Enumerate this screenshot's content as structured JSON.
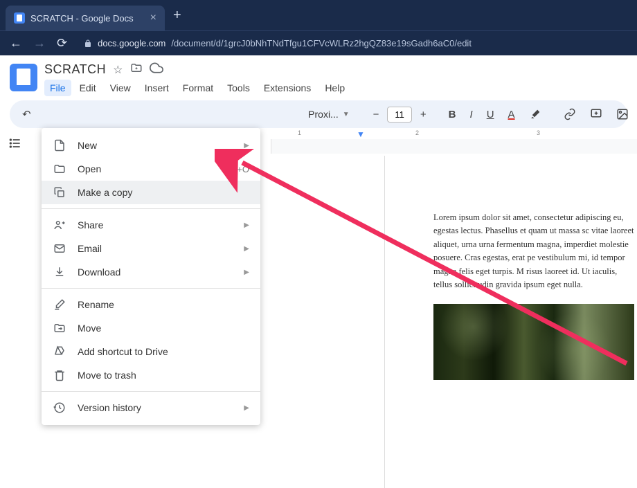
{
  "browser": {
    "tab_title": "SCRATCH - Google Docs",
    "url_host": "docs.google.com",
    "url_path": "/document/d/1grcJ0bNhTNdTfgu1CFVcWLRz2hgQZ83e19sGadh6aC0/edit"
  },
  "doc": {
    "title": "SCRATCH"
  },
  "menus": {
    "items": [
      "File",
      "Edit",
      "View",
      "Insert",
      "Format",
      "Tools",
      "Extensions",
      "Help"
    ],
    "active": "File"
  },
  "toolbar": {
    "font": "Proxi...",
    "size": "11"
  },
  "file_menu": {
    "groups": [
      [
        {
          "icon": "file",
          "label": "New",
          "arrow": true
        },
        {
          "icon": "folder",
          "label": "Open",
          "shortcut": "Ctrl+O"
        },
        {
          "icon": "copy",
          "label": "Make a copy",
          "highlighted": true
        }
      ],
      [
        {
          "icon": "share",
          "label": "Share",
          "arrow": true
        },
        {
          "icon": "email",
          "label": "Email",
          "arrow": true
        },
        {
          "icon": "download",
          "label": "Download",
          "arrow": true
        }
      ],
      [
        {
          "icon": "rename",
          "label": "Rename"
        },
        {
          "icon": "move",
          "label": "Move"
        },
        {
          "icon": "drive",
          "label": "Add shortcut to Drive"
        },
        {
          "icon": "trash",
          "label": "Move to trash"
        }
      ],
      [
        {
          "icon": "history",
          "label": "Version history",
          "arrow": true
        }
      ]
    ]
  },
  "ruler": {
    "ticks": [
      "1",
      "2",
      "3"
    ]
  },
  "body_text": "Lorem ipsum dolor sit amet, consectetur adipiscing eu, egestas lectus. Phasellus et quam ut massa sc vitae laoreet aliquet, urna urna fermentum magna, imperdiet molestie posuere. Cras egestas, erat pe vestibulum mi, id tempor magna felis eget turpis. M risus laoreet id. Ut iaculis, tellus sollicitudin gravida ipsum eget nulla."
}
